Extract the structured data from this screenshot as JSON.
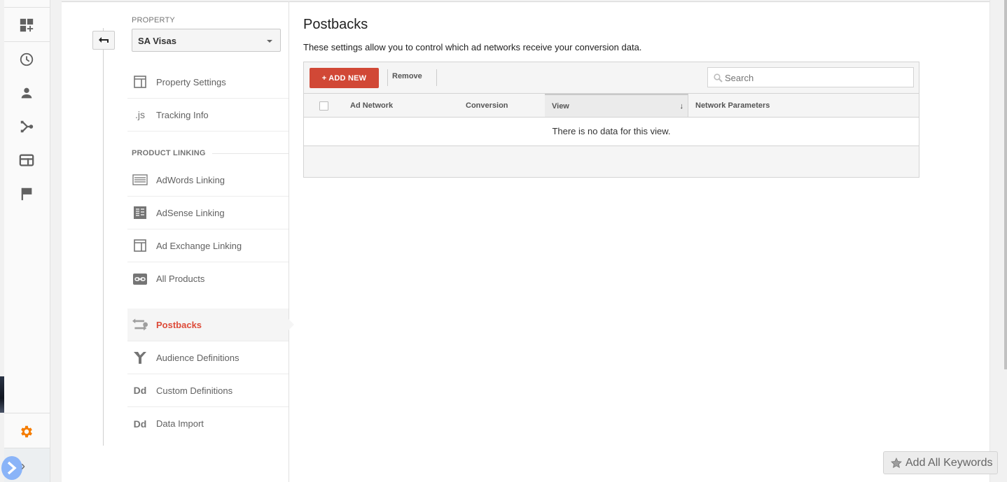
{
  "rail": {
    "icons": [
      "customize-dashboard-icon",
      "clock-icon",
      "person-icon",
      "acquisition-icon",
      "behavior-icon",
      "flag-icon"
    ],
    "settings_icon": "gear-icon",
    "settings_color": "#f57c00",
    "expand_icon": "chevron-right-icon"
  },
  "nav": {
    "back_icon": "back-arrow-icon",
    "property_label": "PROPERTY",
    "property_value": "SA Visas",
    "items_top": [
      {
        "label": "Property Settings",
        "icon": "layout-icon"
      },
      {
        "label": "Tracking Info",
        "icon": "js-icon",
        "icon_text": ".js"
      }
    ],
    "section_heading": "PRODUCT LINKING",
    "items_linking": [
      {
        "label": "AdWords Linking",
        "icon": "adwords-icon"
      },
      {
        "label": "AdSense Linking",
        "icon": "adsense-icon"
      },
      {
        "label": "Ad Exchange Linking",
        "icon": "ad-exchange-icon"
      },
      {
        "label": "All Products",
        "icon": "link-icon"
      }
    ],
    "items_bottom": [
      {
        "label": "Postbacks",
        "icon": "postbacks-icon",
        "active": true
      },
      {
        "label": "Audience Definitions",
        "icon": "audience-icon"
      },
      {
        "label": "Custom Definitions",
        "icon": "dd-icon",
        "icon_text": "Dd"
      },
      {
        "label": "Data Import",
        "icon": "dd-icon",
        "icon_text": "Dd"
      }
    ],
    "active_color": "#dd4b39"
  },
  "main": {
    "title": "Postbacks",
    "description": "These settings allow you to control which ad networks receive your conversion data.",
    "toolbar": {
      "add_label": "+ ADD NEW",
      "add_color": "#d14836",
      "remove_label": "Remove",
      "search_placeholder": "Search",
      "search_value": ""
    },
    "table": {
      "columns": [
        "Ad Network",
        "Conversion",
        "View",
        "Network Parameters"
      ],
      "sorted_column": "View",
      "sort_direction": "descending",
      "sort_glyph": "↓",
      "rows": [],
      "empty_message": "There is no data for this view."
    }
  },
  "floating": {
    "add_keywords_label": "Add All Keywords"
  }
}
